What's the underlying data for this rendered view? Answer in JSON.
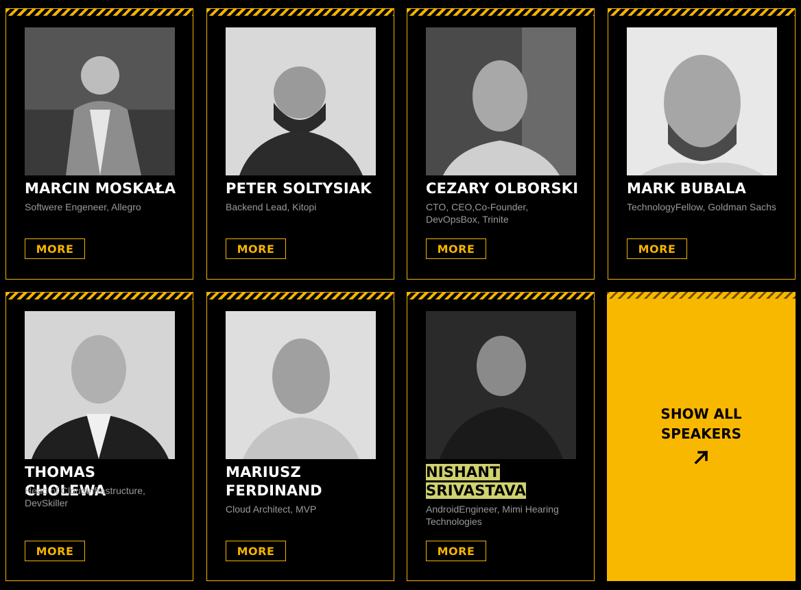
{
  "speakers": [
    {
      "name": "MARCIN MOSKAŁA",
      "role": "Softwere Engeneer, Allegro",
      "more": "MORE"
    },
    {
      "name": "PETER SOLTYSIAK",
      "role": "Backend Lead, Kitopi",
      "more": "MORE"
    },
    {
      "name": "CEZARY OLBORSKI",
      "role": "CTO, CEO,Co-Founder, DevOpsBox, Trinite",
      "more": "MORE"
    },
    {
      "name": "MARK BUBALA",
      "role": "TechnologyFellow, Goldman Sachs",
      "more": "MORE"
    },
    {
      "name": "THOMAS CHOLEWA",
      "role": "Head of CloudInfrastructure, DevSkiller",
      "more": "MORE"
    },
    {
      "name": "MARIUSZ FERDINAND",
      "role": "Cloud Architect, MVP",
      "more": "MORE"
    },
    {
      "name_line1": "NISHANT",
      "name_line2": "SRIVASTAVA",
      "role": "AndroidEngineer, Mimi Hearing Technologies",
      "more": "MORE"
    }
  ],
  "show_all": {
    "line1": "SHOW ALL",
    "line2": "SPEAKERS",
    "icon": "arrow-up-right-icon"
  },
  "colors": {
    "accent": "#f5b400",
    "background": "#000000",
    "highlight": "#cfd26e"
  }
}
